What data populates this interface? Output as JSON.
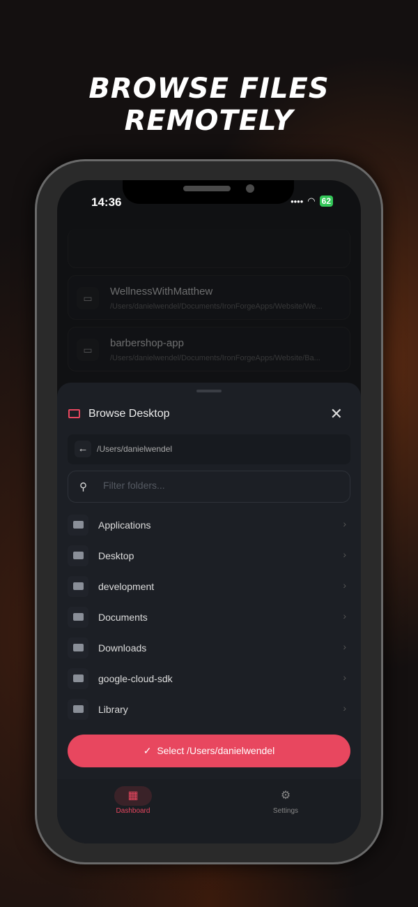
{
  "headline": "BROWSE FILES REMOTELY",
  "status": {
    "time": "14:36",
    "battery": "62"
  },
  "nav": {
    "title": "New Session"
  },
  "recent": [
    {
      "name": "WellnessWithMatthew",
      "path": "/Users/danielwendel/Documents/IronForgeApps/Website/We..."
    },
    {
      "name": "barbershop-app",
      "path": "/Users/danielwendel/Documents/IronForgeApps/Website/Ba..."
    }
  ],
  "sheet": {
    "title": "Browse Desktop",
    "path": "/Users/danielwendel",
    "filter_placeholder": "Filter folders...",
    "folders": [
      "Applications",
      "Desktop",
      "development",
      "Documents",
      "Downloads",
      "google-cloud-sdk",
      "Library"
    ],
    "select_label": "Select /Users/danielwendel"
  },
  "tabs": [
    {
      "label": "Dashboard"
    },
    {
      "label": "Settings"
    }
  ],
  "colors": {
    "accent": "#e8475f"
  }
}
